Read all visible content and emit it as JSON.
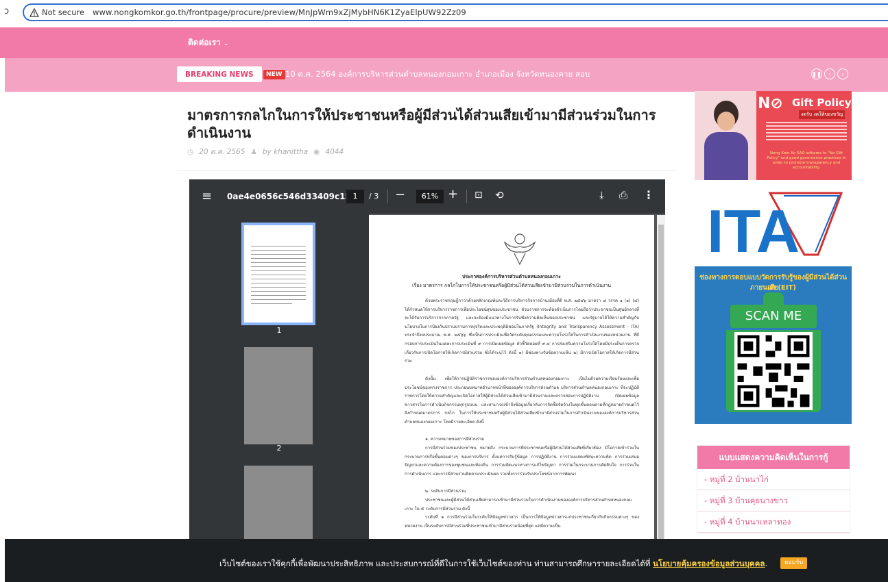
{
  "browser": {
    "back_glyph": "ɔ",
    "security_label": "Not secure",
    "url": "www.nongkomkor.go.th/frontpage/procure/preview/MnJpWm9xZjMybHN6K1ZyaElpUW92Zz09"
  },
  "nav": {
    "contact_label": "ติดต่อเรา",
    "chevron": "⌄"
  },
  "news": {
    "breaking_label": "BREAKING NEWS",
    "new_badge": "NEW",
    "ticker_text": "10 ต.ค. 2564 องค์การบริหารส่วนตำบลหนองกอมเกาะ อำเภอเมือง จังหวัดหนองคาย สอบ",
    "controls": [
      "❚❚",
      "‹",
      "›"
    ]
  },
  "article": {
    "title": "มาตรการกลไกในการให้ประชาชนหรือผู้มีส่วนได้ส่วนเสียเข้ามามีส่วนร่วมในการดำเนินงาน",
    "date": "20 ต.ค. 2565",
    "author": "by khanittha",
    "views": "4044"
  },
  "pdf": {
    "filename": "0ae4e0656c546d33409c15...",
    "current_page": "1",
    "total_pages": "/ 3",
    "zoom": "61%",
    "thumb_labels": [
      "1",
      "2"
    ],
    "doc_header_1": "ประกาศองค์การบริหารส่วนตำบลหนองกอมเกาะ",
    "doc_header_2": "เรื่อง มาตรการ กลไกในการให้ประชาชนหรือผู้มีส่วนได้ส่วนเสียเข้ามามีส่วนร่วมในการดำเนินงาน",
    "doc_paragraphs": [
      "ด้วยพระราชกฤษฎีกาว่าด้วยหลักเกณฑ์และวิธีการบริหารกิจการบ้านเมืองที่ดี พ.ศ. ๒๕๔๖ มาตรา ๘ วรรค ๑ (๑) (๔) ได้กำหนดให้การบริหารราชการเพื่อประโยชน์สุขของประชาชน ส่วนราชการจะต้องดำเนินการโดยถือว่าประชาชนเป็นศูนย์กลางที่จะได้รับการบริการจากภาครัฐ และจะต้องมีแนวทางในการรับฟังความคิดเห็นของประชาชน และรัฐบาลได้ให้ความสำคัญกับนโยบายในการป้องกันปราบปรามการทุจริตและประพฤติมิชอบในภาครัฐ (Integrity and Transparency Assessment - ITA) ประจำปีงบประมาณ พ.ศ. ๒๕๖๖ ซึ่งเป็นการประเมินเพื่อวัดระดับคุณธรรมและความโปร่งใสในการดำเนินงานของหน่วยงาน ที่มีกรอบการประเมินในแต่ละการประเมินที่ ๙ การเปิดเผยข้อมูล ตัวชี้วัดย่อยที่ ๙.๔ การส่งเสริมความโปร่งใสโดยมีประเด็นการตรวจเกี่ยวกับการเปิดโอกาสให้เกิดการมีส่วนร่วม ซึ่งได้ระบุไว้ ดังนี้ ๑) มีช่องทางรับข้อความเห็น ๒) มีการเปิดโอกาสให้เกิดการมีส่วนร่วม",
      "ดังนั้น เพื่อให้การปฏิบัติราชการขององค์การบริหารส่วนตำบลหนองกอมเกาะ เป็นไปด้วยความเรียบร้อยและเพื่อประโยชน์ของทางราชการ ประกอบบทบาทอำนาจหน้าที่ขององค์การบริหารส่วนตำบล บริหารส่วนตำบลหนองกอมเกาะ ที่จะปฏิบัติราชการโดยให้ความสำคัญและเปิดโอกาสให้ผู้มีส่วนได้ส่วนเสียเข้ามามีส่วนร่วมและตรวจสอบการปฏิบัติงาน เปิดเผยข้อมูลข่าวสารในการดำเนินกิจกรรมทุกรูปแบบ และสามารถเข้าถึงข้อมูลเกี่ยวกับการจัดซื้อจัดจ้างในทุกขั้นตอนตามที่กฎหมายกำหนดไว้ จึงกำหนดมาตรการ กลไก ในการให้ประชาชนหรือผู้มีส่วนได้ส่วนเสียเข้ามามีส่วนร่วมในการดำเนินงานขององค์การบริหารส่วนตำบลหนองกอมเกาะ โดยมีรายละเอียด ดังนี้",
      "๑. ความหมายของการมีส่วนร่วม",
      "การมีส่วนร่วมของประชาชน หมายถึง กระบวนการที่ประชาชนหรือผู้มีส่วนได้ส่วนเสียที่เกี่ยวข้อง มีโอกาสเข้าร่วมในกระบวนการหรือขั้นตอนต่างๆ ของการบริหาร ตั้งแต่การรับรู้ข้อมูล การปฏิบัติงาน การร่วมแสดงทัศนะความคิด การร่วมเสนอปัญหาและความต้องการของชุมชนและท้องถิ่น การร่วมคิดแนวทางการแก้ไขปัญหา การร่วมในกระบวนการตัดสินใจ การร่วมในการดำเนินการ และการมีส่วนร่วมติดตามประเมินผล รวมทั้งการร่วมรับประโยชน์จากการพัฒนา",
      "๒. ระดับการมีส่วนร่วม",
      "ประชาชนและผู้มีส่วนได้ส่วนเสียสามารถเข้ามามีส่วนร่วมในการดำเนินงานขององค์การบริหารส่วนตำบลหนองกอมเกาะ ใน ๕ ระดับการมีส่วนร่วม ดังนี้",
      "ระดับที่ ๑ การมีส่วนร่วมในระดับให้ข้อมูลข่าวสาร เป็นการให้ข้อมูลข่าวสารแก่ประชาชนเกี่ยวกับกิจกรรมต่างๆ ของหน่วยงาน เป็นระดับการมีส่วนร่วมที่ประชาชนเข้ามามีส่วนร่วมน้อยที่สุด แต่มีความเป็น"
    ]
  },
  "sidebar": {
    "gift": {
      "title": "Gift Policy",
      "subtitle": "งดรับ งดให้ของขวัญ",
      "en_text": "Nong Kom Ko SAO adheres to \"No Gift Policy\" and good governance practices in order to promote transparency and accountability."
    },
    "ita_label": "ITA",
    "scan": {
      "title_1": "ช่องทางการตอบแบบวัดการรับรู้ของผู้มีส่วนได้ส่วนเสีย",
      "title_2": "ภายนอก (EIT)",
      "button_label": "SCAN ME"
    },
    "opinion": {
      "heading": "แบบแสดงความคิดเห็นในการกู้",
      "items": [
        "- หมู่ที่ 2 บ้านนาไก่",
        "- หมู่ที่ 3 บ้านคุยนางขาว",
        "- หมู่ที่ 4 บ้านนาเหลาทอง"
      ]
    }
  },
  "cookie": {
    "text": "เว็บไซต์ของเราใช้คุกกี้เพื่อพัฒนาประสิทธิภาพ และประสบการณ์ที่ดีในการใช้เว็บไซต์ของท่าน ท่านสามารถศึกษารายละเอียดได้ที่",
    "link_label": "นโยบายคุ้มครองข้อมูลส่วนบุคคล",
    "accept_label": "ยอมรับ"
  },
  "colors": {
    "nav_pink": "#f27aa8",
    "news_pink": "#f5a3c2",
    "pdf_toolbar": "#323639",
    "cookie_bg": "#1b1e20",
    "accent_yellow": "#ffd54a"
  }
}
